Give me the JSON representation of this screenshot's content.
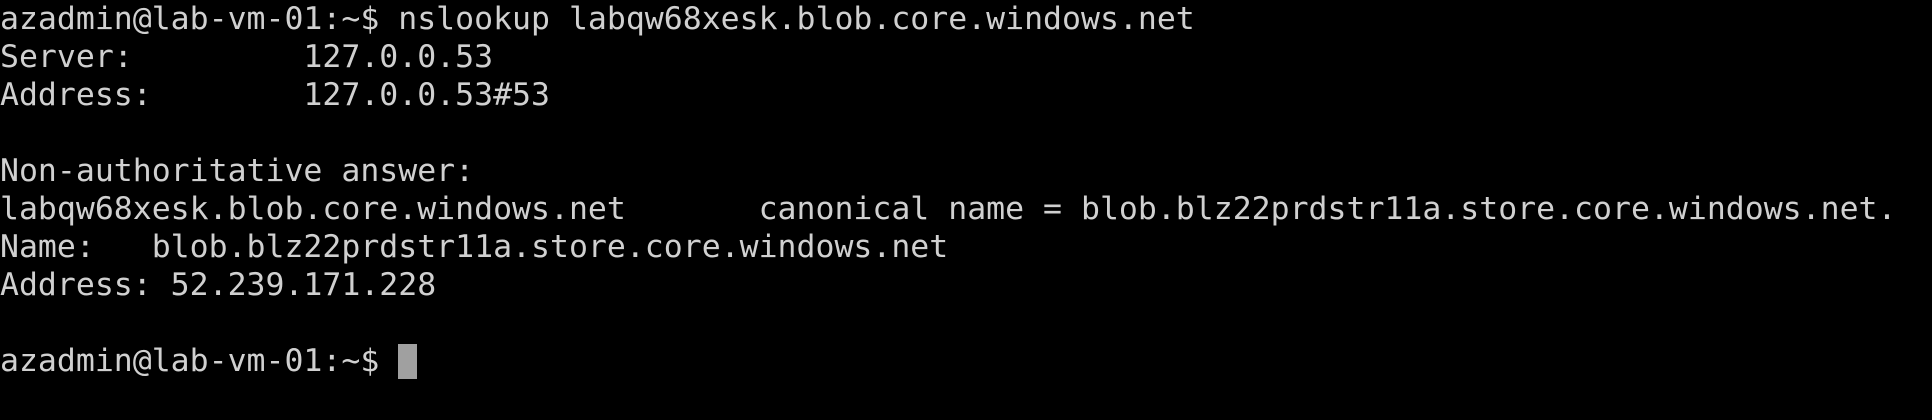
{
  "terminal": {
    "lines": [
      "azadmin@lab-vm-01:~$ nslookup labqw68xesk.blob.core.windows.net",
      "Server:         127.0.0.53",
      "Address:        127.0.0.53#53",
      "",
      "Non-authoritative answer:",
      "labqw68xesk.blob.core.windows.net       canonical name = blob.blz22prdstr11a.store.core.windows.net.",
      "Name:   blob.blz22prdstr11a.store.core.windows.net",
      "Address: 52.239.171.228",
      ""
    ],
    "prompt": "azadmin@lab-vm-01:~$ "
  },
  "colors": {
    "background": "#000000",
    "text": "#d0d0d0",
    "cursor": "#a0a0a0"
  }
}
